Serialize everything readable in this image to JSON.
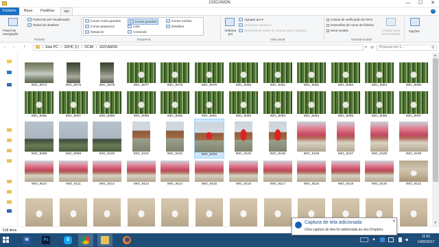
{
  "window": {
    "title": "102CANON",
    "minimize": "—",
    "maximize": "☐",
    "close": "✕"
  },
  "ribbon_tabs": [
    "Ficheiro",
    "Base",
    "Partilhar",
    "Ver"
  ],
  "ribbon": {
    "panes": {
      "nav_pane": "Painel de navegação",
      "preview": "Painel de pré-visualização",
      "details": "Painel de detalhes",
      "label": "Painéis"
    },
    "layout": {
      "items": [
        "Ícones muito grandes",
        "Ícones grandes",
        "Ícones médios",
        "Ícones pequenos",
        "Lista",
        "Detalhes",
        "Mosaicos",
        "Conteúdo"
      ],
      "label": "Esquema"
    },
    "current_view": {
      "sort_by": "Ordenar por",
      "group_by": "Agrupar por",
      "add_columns": "Adicionar colunas",
      "size_columns": "Dimensionar todas as colunas para caberem",
      "label": "Vista atual"
    },
    "show_hide": {
      "checkboxes": "Caixas de verificação de itens",
      "extensions": "Extensões de nome de ficheiro",
      "hidden": "Itens ocultos",
      "hide_selected": "Ocultar itens selecionados",
      "label": "Mostrar/ocultar"
    },
    "options": "Opções"
  },
  "address": {
    "back": "←",
    "forward": "→",
    "up": "↑",
    "path": [
      "Este PC",
      "SDHC (I:)",
      "DCIM",
      "102CANON"
    ],
    "search_placeholder": "Procurar em 1..."
  },
  "files": {
    "rows": [
      [
        "IMG_9074",
        "IMG_9075",
        "IMG_9076",
        "IMG_9077",
        "IMG_9078",
        "IMG_9079",
        "IMG_9080",
        "IMG_9081",
        "IMG_9082",
        "IMG_9083",
        "IMG_9084",
        "IMG_9085"
      ],
      [
        "IMG_9086",
        "IMG_9087",
        "IMG_9088",
        "IMG_9089",
        "IMG_9090",
        "IMG_9091",
        "IMG_9092",
        "IMG_9093",
        "IMG_9094",
        "IMG_9095",
        "IMG_9096",
        "IMG_9097"
      ],
      [
        "IMG_9098",
        "IMG_9099",
        "IMG_9100",
        "IMG_9101",
        "IMG_9102",
        "IMG_9103",
        "IMG_9104",
        "IMG_9105",
        "IMG_9106",
        "IMG_9107",
        "IMG_9108",
        "IMG_9109"
      ],
      [
        "IMG_9110",
        "IMG_9111",
        "IMG_9112",
        "IMG_9113",
        "IMG_9114",
        "IMG_9115",
        "IMG_9116",
        "IMG_9117",
        "IMG_9118",
        "IMG_9119",
        "IMG_9120",
        "IMG_9121"
      ]
    ],
    "selected": "IMG_9103"
  },
  "status": {
    "count": "518 itens"
  },
  "toast": {
    "title": "Captura de tela adicionada",
    "message": "Uma captura de tela foi adicionada ao seu Dropbox.",
    "close": "✕"
  },
  "taskbar": {
    "apps": [
      "Word",
      "Photoshop",
      "Skype",
      "Chrome",
      "Explorador de Ficheiros",
      "Firefox"
    ],
    "time": "11:52",
    "date": "14/06/2017"
  }
}
